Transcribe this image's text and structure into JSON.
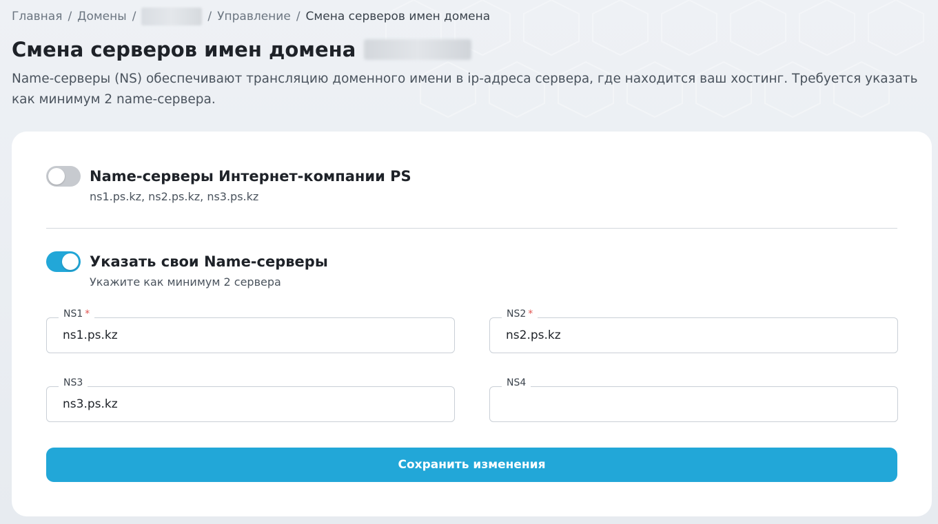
{
  "breadcrumb": {
    "home": "Главная",
    "domains": "Домены",
    "manage": "Управление",
    "current": "Смена серверов имен домена",
    "separator": "/"
  },
  "page": {
    "title": "Смена серверов имен домена",
    "description": "Name-серверы (NS) обеспечивают трансляцию доменного имени в ip-адреса сервера, где находится ваш хостинг. Требуется указать как минимум 2 name-сервера."
  },
  "options": {
    "company": {
      "title": "Name-серверы Интернет-компании PS",
      "subtitle": "ns1.ps.kz, ns2.ps.kz, ns3.ps.kz",
      "enabled": false
    },
    "custom": {
      "title": "Указать свои Name-серверы",
      "subtitle": "Укажите как минимум 2 сервера",
      "enabled": true
    }
  },
  "fields": {
    "ns1": {
      "label": "NS1",
      "required": "*",
      "value": "ns1.ps.kz"
    },
    "ns2": {
      "label": "NS2",
      "required": "*",
      "value": "ns2.ps.kz"
    },
    "ns3": {
      "label": "NS3",
      "value": "ns3.ps.kz"
    },
    "ns4": {
      "label": "NS4",
      "value": ""
    }
  },
  "actions": {
    "save_label": "Сохранить изменения"
  },
  "colors": {
    "accent": "#22a7d8",
    "toggle_off": "#c7cacf",
    "required": "#e0524f"
  }
}
